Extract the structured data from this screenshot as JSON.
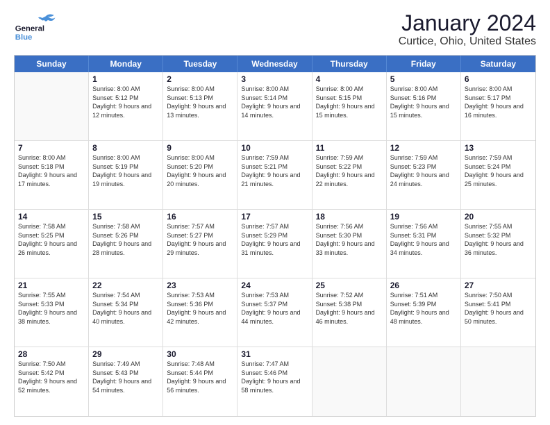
{
  "logo": {
    "general": "General",
    "blue": "Blue"
  },
  "title": "January 2024",
  "subtitle": "Curtice, Ohio, United States",
  "weekdays": [
    "Sunday",
    "Monday",
    "Tuesday",
    "Wednesday",
    "Thursday",
    "Friday",
    "Saturday"
  ],
  "weeks": [
    [
      {
        "day": "",
        "empty": true
      },
      {
        "day": "1",
        "sunrise": "Sunrise: 8:00 AM",
        "sunset": "Sunset: 5:12 PM",
        "daylight": "Daylight: 9 hours and 12 minutes."
      },
      {
        "day": "2",
        "sunrise": "Sunrise: 8:00 AM",
        "sunset": "Sunset: 5:13 PM",
        "daylight": "Daylight: 9 hours and 13 minutes."
      },
      {
        "day": "3",
        "sunrise": "Sunrise: 8:00 AM",
        "sunset": "Sunset: 5:14 PM",
        "daylight": "Daylight: 9 hours and 14 minutes."
      },
      {
        "day": "4",
        "sunrise": "Sunrise: 8:00 AM",
        "sunset": "Sunset: 5:15 PM",
        "daylight": "Daylight: 9 hours and 15 minutes."
      },
      {
        "day": "5",
        "sunrise": "Sunrise: 8:00 AM",
        "sunset": "Sunset: 5:16 PM",
        "daylight": "Daylight: 9 hours and 15 minutes."
      },
      {
        "day": "6",
        "sunrise": "Sunrise: 8:00 AM",
        "sunset": "Sunset: 5:17 PM",
        "daylight": "Daylight: 9 hours and 16 minutes."
      }
    ],
    [
      {
        "day": "7",
        "sunrise": "Sunrise: 8:00 AM",
        "sunset": "Sunset: 5:18 PM",
        "daylight": "Daylight: 9 hours and 17 minutes."
      },
      {
        "day": "8",
        "sunrise": "Sunrise: 8:00 AM",
        "sunset": "Sunset: 5:19 PM",
        "daylight": "Daylight: 9 hours and 19 minutes."
      },
      {
        "day": "9",
        "sunrise": "Sunrise: 8:00 AM",
        "sunset": "Sunset: 5:20 PM",
        "daylight": "Daylight: 9 hours and 20 minutes."
      },
      {
        "day": "10",
        "sunrise": "Sunrise: 7:59 AM",
        "sunset": "Sunset: 5:21 PM",
        "daylight": "Daylight: 9 hours and 21 minutes."
      },
      {
        "day": "11",
        "sunrise": "Sunrise: 7:59 AM",
        "sunset": "Sunset: 5:22 PM",
        "daylight": "Daylight: 9 hours and 22 minutes."
      },
      {
        "day": "12",
        "sunrise": "Sunrise: 7:59 AM",
        "sunset": "Sunset: 5:23 PM",
        "daylight": "Daylight: 9 hours and 24 minutes."
      },
      {
        "day": "13",
        "sunrise": "Sunrise: 7:59 AM",
        "sunset": "Sunset: 5:24 PM",
        "daylight": "Daylight: 9 hours and 25 minutes."
      }
    ],
    [
      {
        "day": "14",
        "sunrise": "Sunrise: 7:58 AM",
        "sunset": "Sunset: 5:25 PM",
        "daylight": "Daylight: 9 hours and 26 minutes."
      },
      {
        "day": "15",
        "sunrise": "Sunrise: 7:58 AM",
        "sunset": "Sunset: 5:26 PM",
        "daylight": "Daylight: 9 hours and 28 minutes."
      },
      {
        "day": "16",
        "sunrise": "Sunrise: 7:57 AM",
        "sunset": "Sunset: 5:27 PM",
        "daylight": "Daylight: 9 hours and 29 minutes."
      },
      {
        "day": "17",
        "sunrise": "Sunrise: 7:57 AM",
        "sunset": "Sunset: 5:29 PM",
        "daylight": "Daylight: 9 hours and 31 minutes."
      },
      {
        "day": "18",
        "sunrise": "Sunrise: 7:56 AM",
        "sunset": "Sunset: 5:30 PM",
        "daylight": "Daylight: 9 hours and 33 minutes."
      },
      {
        "day": "19",
        "sunrise": "Sunrise: 7:56 AM",
        "sunset": "Sunset: 5:31 PM",
        "daylight": "Daylight: 9 hours and 34 minutes."
      },
      {
        "day": "20",
        "sunrise": "Sunrise: 7:55 AM",
        "sunset": "Sunset: 5:32 PM",
        "daylight": "Daylight: 9 hours and 36 minutes."
      }
    ],
    [
      {
        "day": "21",
        "sunrise": "Sunrise: 7:55 AM",
        "sunset": "Sunset: 5:33 PM",
        "daylight": "Daylight: 9 hours and 38 minutes."
      },
      {
        "day": "22",
        "sunrise": "Sunrise: 7:54 AM",
        "sunset": "Sunset: 5:34 PM",
        "daylight": "Daylight: 9 hours and 40 minutes."
      },
      {
        "day": "23",
        "sunrise": "Sunrise: 7:53 AM",
        "sunset": "Sunset: 5:36 PM",
        "daylight": "Daylight: 9 hours and 42 minutes."
      },
      {
        "day": "24",
        "sunrise": "Sunrise: 7:53 AM",
        "sunset": "Sunset: 5:37 PM",
        "daylight": "Daylight: 9 hours and 44 minutes."
      },
      {
        "day": "25",
        "sunrise": "Sunrise: 7:52 AM",
        "sunset": "Sunset: 5:38 PM",
        "daylight": "Daylight: 9 hours and 46 minutes."
      },
      {
        "day": "26",
        "sunrise": "Sunrise: 7:51 AM",
        "sunset": "Sunset: 5:39 PM",
        "daylight": "Daylight: 9 hours and 48 minutes."
      },
      {
        "day": "27",
        "sunrise": "Sunrise: 7:50 AM",
        "sunset": "Sunset: 5:41 PM",
        "daylight": "Daylight: 9 hours and 50 minutes."
      }
    ],
    [
      {
        "day": "28",
        "sunrise": "Sunrise: 7:50 AM",
        "sunset": "Sunset: 5:42 PM",
        "daylight": "Daylight: 9 hours and 52 minutes."
      },
      {
        "day": "29",
        "sunrise": "Sunrise: 7:49 AM",
        "sunset": "Sunset: 5:43 PM",
        "daylight": "Daylight: 9 hours and 54 minutes."
      },
      {
        "day": "30",
        "sunrise": "Sunrise: 7:48 AM",
        "sunset": "Sunset: 5:44 PM",
        "daylight": "Daylight: 9 hours and 56 minutes."
      },
      {
        "day": "31",
        "sunrise": "Sunrise: 7:47 AM",
        "sunset": "Sunset: 5:46 PM",
        "daylight": "Daylight: 9 hours and 58 minutes."
      },
      {
        "day": "",
        "empty": true
      },
      {
        "day": "",
        "empty": true
      },
      {
        "day": "",
        "empty": true
      }
    ]
  ]
}
